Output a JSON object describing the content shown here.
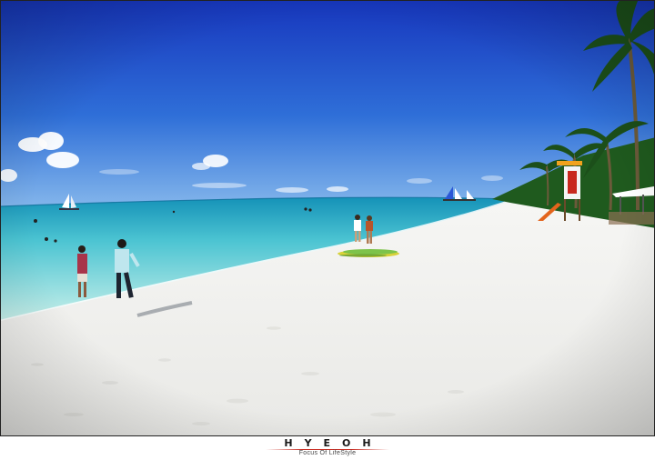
{
  "watermark": {
    "brand": "HYEOH",
    "tagline": "Focus Of LifeStyle"
  },
  "colors": {
    "sky_top": "#1a3fc4",
    "sky_horizon": "#7fb2ea",
    "sea_far": "#1c9fc0",
    "sea_near": "#b9ecea",
    "sand": "#f4f4f2",
    "accent_red": "#c8281e"
  }
}
